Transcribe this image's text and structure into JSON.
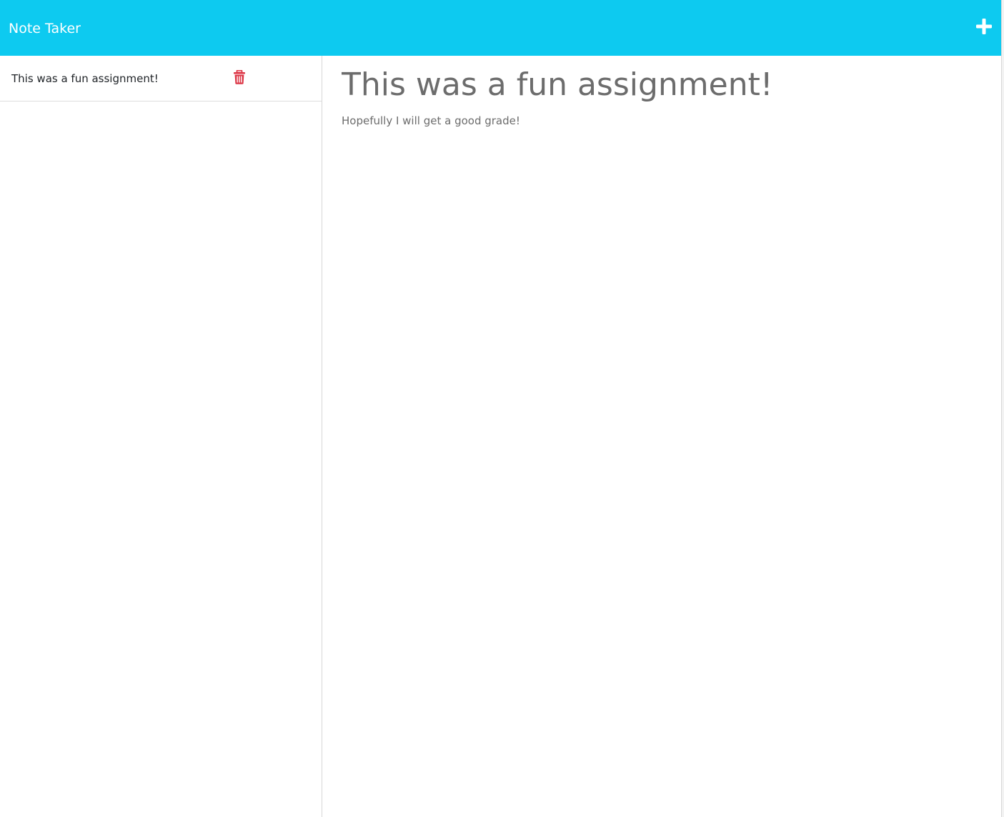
{
  "app": {
    "title": "Note Taker",
    "accent_color": "#0dcaf0",
    "danger_color": "#dc3545"
  },
  "navbar": {
    "new_note_icon": "plus-icon"
  },
  "sidebar": {
    "notes": [
      {
        "title": "This was a fun assignment!",
        "delete_icon": "trash-icon"
      }
    ]
  },
  "main": {
    "note_title": "This was a fun assignment!",
    "note_text": "Hopefully I will get a good grade!"
  }
}
